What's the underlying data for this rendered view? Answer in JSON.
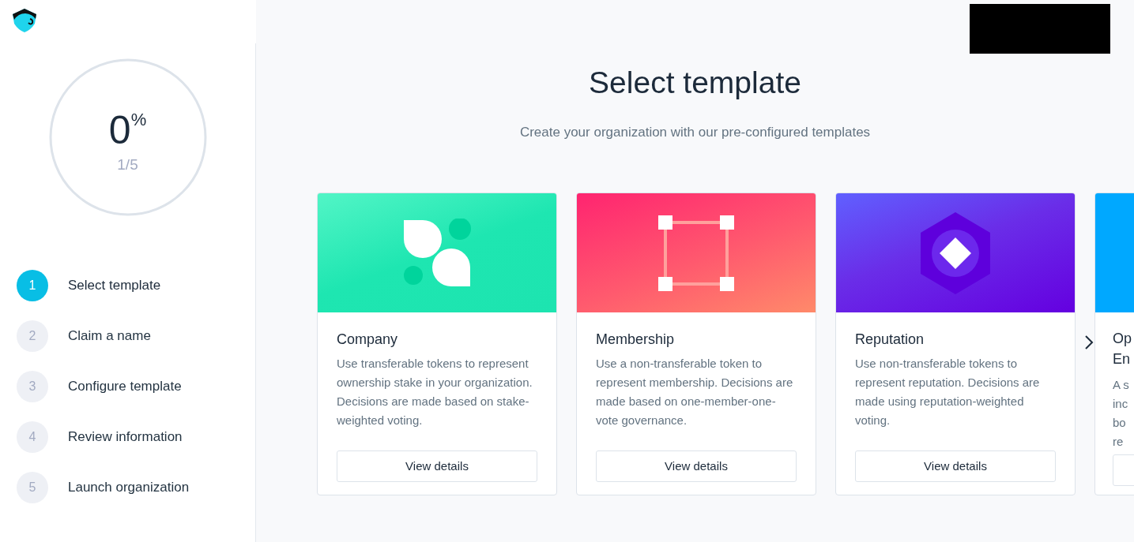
{
  "progress": {
    "percent": "0",
    "unit": "%",
    "step_count": "1/5"
  },
  "steps": [
    {
      "number": "1",
      "label": "Select template",
      "selected": true
    },
    {
      "number": "2",
      "label": "Claim a name",
      "selected": false
    },
    {
      "number": "3",
      "label": "Configure template",
      "selected": false
    },
    {
      "number": "4",
      "label": "Review information",
      "selected": false
    },
    {
      "number": "5",
      "label": "Launch organization",
      "selected": false
    }
  ],
  "heading": "Select template",
  "subtitle": "Create your organization with our pre-configured templates",
  "cards": [
    {
      "kind": "company",
      "title": "Company",
      "description": "Use transferable tokens to represent ownership stake in your organization. Decisions are made based on stake-weighted voting.",
      "button": "View details"
    },
    {
      "kind": "membership",
      "title": "Membership",
      "description": "Use a non-transferable token to represent membership. Decisions are made based on one-member-one-vote governance.",
      "button": "View details"
    },
    {
      "kind": "reputation",
      "title": "Reputation",
      "description": "Use non-transferable tokens to represent reputation. Decisions are made using reputation-weighted voting.",
      "button": "View details"
    },
    {
      "kind": "partial",
      "title_lines": [
        "Op",
        "En"
      ],
      "description_lines": [
        "A s",
        "inc",
        "bo",
        "re"
      ]
    }
  ]
}
